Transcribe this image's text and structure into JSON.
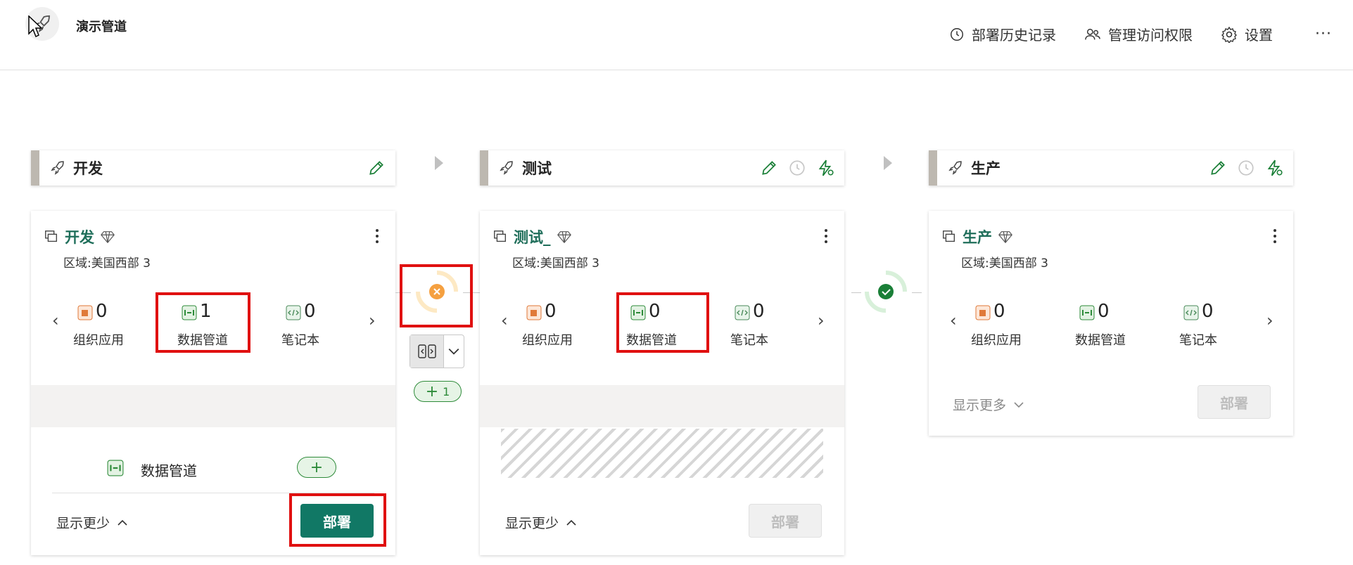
{
  "header": {
    "title": "演示管道",
    "actions": [
      {
        "label": "部署历史记录",
        "icon": "history-icon"
      },
      {
        "label": "管理访问权限",
        "icon": "people-icon"
      },
      {
        "label": "设置",
        "icon": "gear-icon"
      }
    ],
    "more": "···"
  },
  "stages": [
    {
      "name": "开发",
      "workspace": "开发",
      "region": "区域:美国西部 3",
      "counts": [
        {
          "value": "0",
          "label": "组织应用"
        },
        {
          "value": "1",
          "label": "数据管道"
        },
        {
          "value": "0",
          "label": "笔记本"
        }
      ],
      "item_label": "数据管道",
      "toggle": "显示更少",
      "deploy": "部署"
    },
    {
      "name": "测试",
      "workspace": "测试_",
      "region": "区域:美国西部 3",
      "counts": [
        {
          "value": "0",
          "label": "组织应用"
        },
        {
          "value": "0",
          "label": "数据管道"
        },
        {
          "value": "0",
          "label": "笔记本"
        }
      ],
      "toggle": "显示更少",
      "deploy": "部署"
    },
    {
      "name": "生产",
      "workspace": "生产",
      "region": "区域:美国西部 3",
      "counts": [
        {
          "value": "0",
          "label": "组织应用"
        },
        {
          "value": "0",
          "label": "数据管道"
        },
        {
          "value": "0",
          "label": "笔记本"
        }
      ],
      "toggle": "显示更多",
      "deploy": "部署"
    }
  ],
  "compare": {
    "diff_count": "1"
  },
  "colors": {
    "accent": "#117865",
    "highlight": "#e01010",
    "stage_bar": "#bdb8b0",
    "warning": "#f5a040",
    "success": "#1a7f37"
  }
}
